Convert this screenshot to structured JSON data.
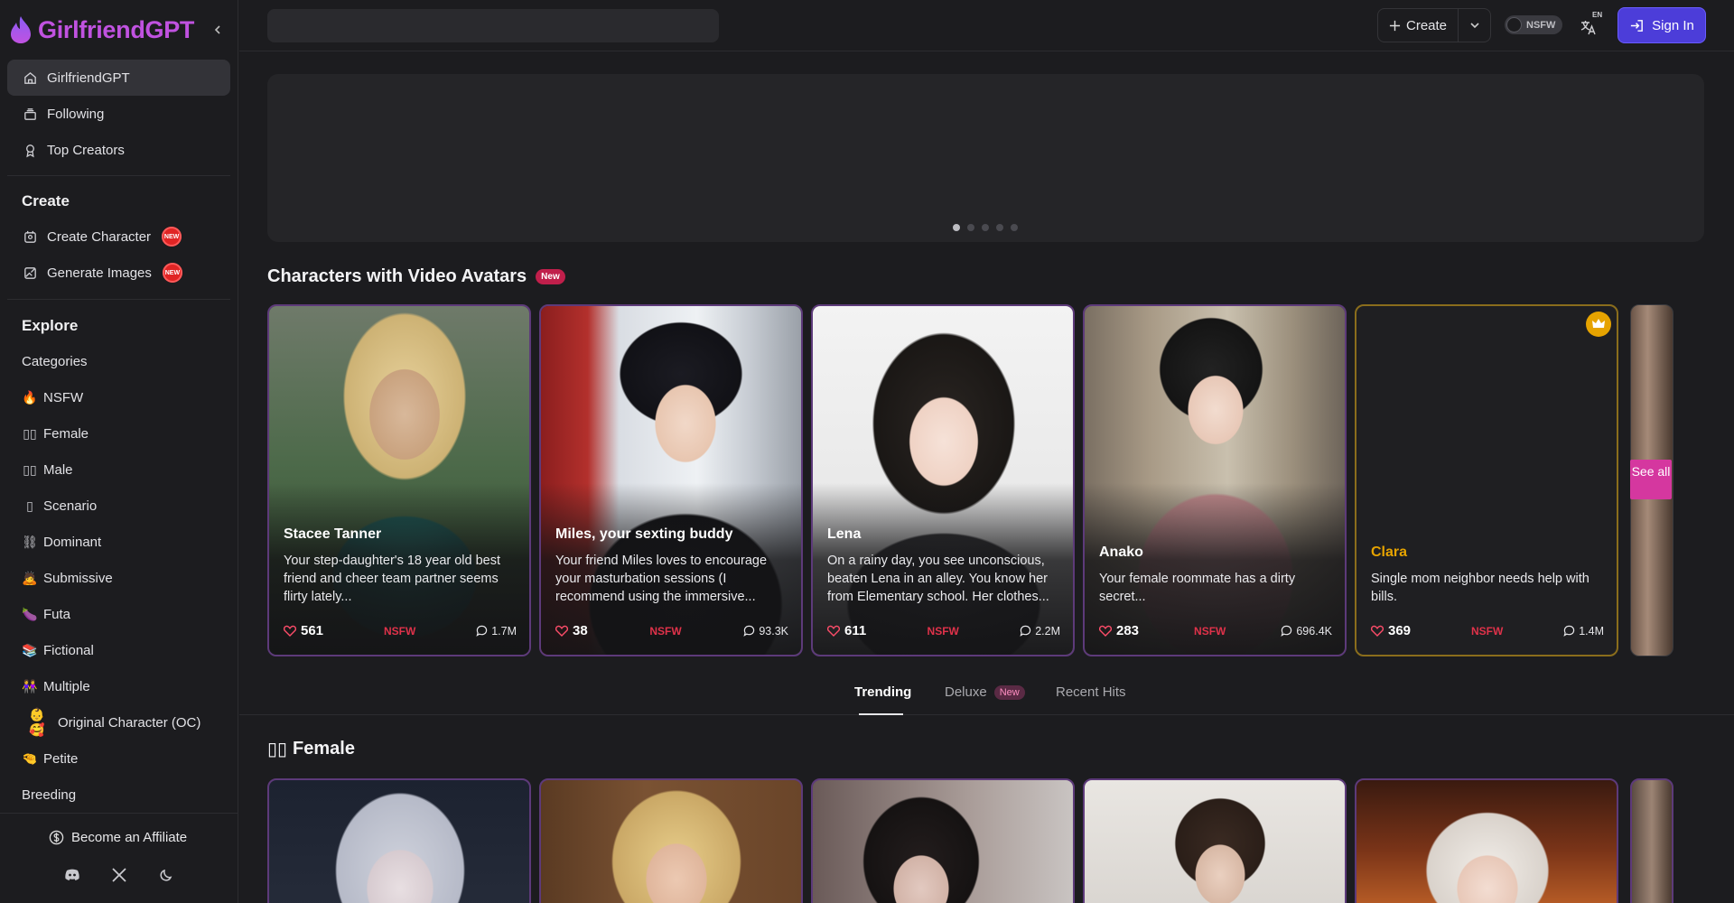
{
  "brand": {
    "name": "GirlfriendGPT"
  },
  "sidebar": {
    "nav": [
      {
        "label": "GirlfriendGPT",
        "icon": "home-icon"
      },
      {
        "label": "Following",
        "icon": "stack-icon"
      },
      {
        "label": "Top Creators",
        "icon": "award-icon"
      }
    ],
    "create_title": "Create",
    "create_items": [
      {
        "label": "Create Character",
        "badge": "NEW"
      },
      {
        "label": "Generate Images",
        "badge": "NEW"
      }
    ],
    "explore_title": "Explore",
    "explore_items": [
      {
        "emoji": "",
        "label": "Categories"
      },
      {
        "emoji": "🔥",
        "label": "NSFW"
      },
      {
        "emoji": "▯▯",
        "label": "Female"
      },
      {
        "emoji": "▯▯",
        "label": "Male"
      },
      {
        "emoji": "▯",
        "label": "Scenario"
      },
      {
        "emoji": "⛓",
        "label": "Dominant"
      },
      {
        "emoji": "🙇",
        "label": "Submissive"
      },
      {
        "emoji": "🍆",
        "label": "Futa"
      },
      {
        "emoji": "📚",
        "label": "Fictional"
      },
      {
        "emoji": "👭",
        "label": "Multiple"
      },
      {
        "emoji": "👶🥰",
        "label": "Original Character (OC)"
      },
      {
        "emoji": "🤏",
        "label": "Petite"
      },
      {
        "emoji": "",
        "label": "Breeding"
      }
    ],
    "affiliate": "Become an Affiliate"
  },
  "topbar": {
    "search_placeholder": "",
    "create_label": "Create",
    "nsfw_label": "NSFW",
    "lang_tag": "EN",
    "signin_label": "Sign In"
  },
  "section_video": {
    "title": "Characters with Video Avatars",
    "badge": "New"
  },
  "cards": [
    {
      "name": "Stacee Tanner",
      "desc": "Your step-daughter's 18 year old best friend and cheer team partner seems flirty lately...",
      "likes": "561",
      "tag": "NSFW",
      "chats": "1.7M"
    },
    {
      "name": "Miles, your sexting buddy",
      "desc": "Your friend Miles loves to encourage your masturbation sessions (I recommend using the immersive...",
      "likes": "38",
      "tag": "NSFW",
      "chats": "93.3K"
    },
    {
      "name": "Lena",
      "desc": "On a rainy day, you see unconscious, beaten Lena in an alley. You know her from Elementary school. Her clothes...",
      "likes": "611",
      "tag": "NSFW",
      "chats": "2.2M"
    },
    {
      "name": "Anako",
      "desc": "Your female roommate has a dirty secret...",
      "likes": "283",
      "tag": "NSFW",
      "chats": "696.4K"
    },
    {
      "name": "Clara",
      "desc": "Single mom neighbor needs help with bills.",
      "likes": "369",
      "tag": "NSFW",
      "chats": "1.4M"
    }
  ],
  "see_all": "See all",
  "tabs": [
    {
      "label": "Trending"
    },
    {
      "label": "Deluxe",
      "badge": "New"
    },
    {
      "label": "Recent Hits"
    }
  ],
  "section_female": {
    "title": "Female",
    "emoji": "▯▯"
  },
  "colors": {
    "brand": "#c052e0",
    "accent": "#4c3dd9",
    "nsfw": "#e0324a",
    "card_border": "#5d3a7a",
    "premium": "#e6a300"
  }
}
